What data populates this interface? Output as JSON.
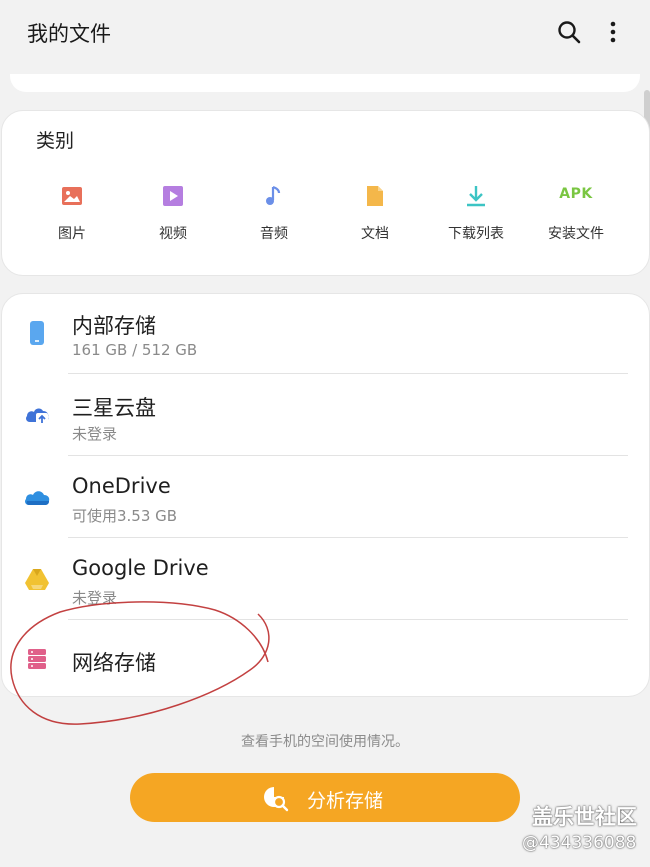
{
  "header": {
    "title": "我的文件",
    "search_icon": "search-icon",
    "more_icon": "more-vert-icon"
  },
  "categories": {
    "title": "类别",
    "items": [
      {
        "label": "图片",
        "icon": "image-icon",
        "color": "#e8705a"
      },
      {
        "label": "视频",
        "icon": "video-icon",
        "color": "#b57ee0"
      },
      {
        "label": "音频",
        "icon": "music-icon",
        "color": "#6b8fe8"
      },
      {
        "label": "文档",
        "icon": "document-icon",
        "color": "#f4b74a"
      },
      {
        "label": "下载列表",
        "icon": "download-icon",
        "color": "#3cc4c4"
      },
      {
        "label": "安装文件",
        "icon": "apk-icon",
        "icon_text": "APK",
        "color": "#7ac642"
      }
    ]
  },
  "storage": {
    "items": [
      {
        "name": "内部存储",
        "sub": "161 GB / 512 GB",
        "icon": "phone-icon",
        "color": "#5aa7ef"
      },
      {
        "name": "三星云盘",
        "sub": "未登录",
        "icon": "cloud-upload-icon",
        "color": "#3f73d8"
      },
      {
        "name": "OneDrive",
        "sub": "可使用3.53 GB",
        "icon": "onedrive-icon",
        "color": "#2f8fe0"
      },
      {
        "name": "Google Drive",
        "sub": "未登录",
        "icon": "google-drive-icon",
        "color": "#f1c232"
      },
      {
        "name": "网络存储",
        "sub": "",
        "icon": "network-storage-icon",
        "color": "#e0608a"
      }
    ]
  },
  "analysis": {
    "hint": "查看手机的空间使用情况。",
    "button_label": "分析存储",
    "button_color": "#f5a623"
  },
  "watermark": {
    "line1": "盖乐世社区",
    "line2": "@434336088"
  }
}
